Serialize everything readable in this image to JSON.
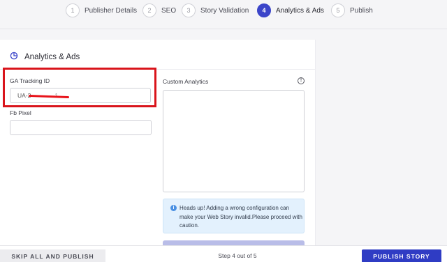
{
  "stepper": {
    "steps": [
      {
        "number": "1",
        "label": "Publisher Details"
      },
      {
        "number": "2",
        "label": "SEO"
      },
      {
        "number": "3",
        "label": "Story Validation"
      },
      {
        "number": "4",
        "label": "Analytics & Ads"
      },
      {
        "number": "5",
        "label": "Publish"
      }
    ],
    "active_step": 4
  },
  "card": {
    "title": "Analytics & Ads",
    "icon": "pie-chart-icon"
  },
  "fields": {
    "ga_label": "GA Tracking ID",
    "ga_value": "UA-2",
    "ga_value_tail": "1",
    "fb_label": "Fb Pixel",
    "fb_value": "",
    "custom_label": "Custom Analytics",
    "custom_value": ""
  },
  "alert": {
    "icon": "info-icon",
    "text": "Heads up! Adding a wrong configuration can make your Web Story invalid.Please proceed with caution."
  },
  "footer": {
    "skip_label": "SKIP ALL AND PUBLISH",
    "step_count": "Step 4 out of 5",
    "publish_label": "PUBLISH STORY"
  },
  "colors": {
    "accent": "#3b45c9",
    "publish_button": "#2f3cc4",
    "highlight_box": "#d9141b",
    "alert_bg": "#e3f1fd"
  }
}
